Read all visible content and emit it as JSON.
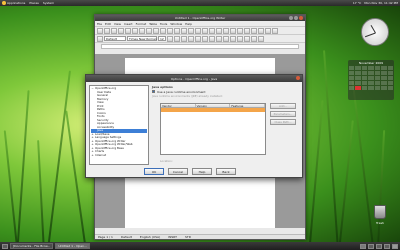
{
  "top_panel": {
    "menus": [
      "Applications",
      "Places",
      "System"
    ],
    "clock": "Mon Nov 30, 11:42 PM",
    "weather": "17 °C"
  },
  "writer": {
    "title": "Untitled 1 - OpenOffice.org Writer",
    "menus": [
      "File",
      "Edit",
      "View",
      "Insert",
      "Format",
      "Table",
      "Tools",
      "Window",
      "Help"
    ],
    "style_select": "Default",
    "font_select": "Times New Roman",
    "size_select": "12",
    "status": {
      "page": "Page 1 / 1",
      "style": "Default",
      "language": "English (USA)",
      "mode": "INSRT",
      "std": "STD"
    }
  },
  "dialog": {
    "title": "Options - OpenOffice.org - Java",
    "tree": [
      {
        "label": "OpenOffice.org",
        "level": 0,
        "expander": "−"
      },
      {
        "label": "User Data",
        "level": 1
      },
      {
        "label": "General",
        "level": 1
      },
      {
        "label": "Memory",
        "level": 1
      },
      {
        "label": "View",
        "level": 1
      },
      {
        "label": "Print",
        "level": 1
      },
      {
        "label": "Paths",
        "level": 1
      },
      {
        "label": "Colors",
        "level": 1
      },
      {
        "label": "Fonts",
        "level": 1
      },
      {
        "label": "Security",
        "level": 1
      },
      {
        "label": "Appearance",
        "level": 1
      },
      {
        "label": "Accessibility",
        "level": 1
      },
      {
        "label": "Java",
        "level": 1,
        "selected": true
      },
      {
        "label": "Load/Save",
        "level": 0,
        "expander": "+"
      },
      {
        "label": "Language Settings",
        "level": 0,
        "expander": "+"
      },
      {
        "label": "OpenOffice.org Writer",
        "level": 0,
        "expander": "+"
      },
      {
        "label": "OpenOffice.org Writer/Web",
        "level": 0,
        "expander": "+"
      },
      {
        "label": "OpenOffice.org Base",
        "level": 0,
        "expander": "+"
      },
      {
        "label": "Charts",
        "level": 0,
        "expander": "+"
      },
      {
        "label": "Internet",
        "level": 0,
        "expander": "+"
      }
    ],
    "section_title": "Java options",
    "checkbox_label": "Use a Java runtime environment",
    "hint": "Java runtime environments (JRE) already installed:",
    "columns": [
      "Vendor",
      "Version",
      "Features"
    ],
    "side_buttons": [
      "Add...",
      "Parameters...",
      "Class Path..."
    ],
    "location_label": "Location:",
    "buttons": [
      "OK",
      "Cancel",
      "Help",
      "Back"
    ]
  },
  "taskbar": {
    "items": [
      "[Documents - File Brow...",
      "Untitled 1 - Open..."
    ]
  },
  "desktop": {
    "calendar_month": "November 2009",
    "trash_label": "Trash"
  }
}
